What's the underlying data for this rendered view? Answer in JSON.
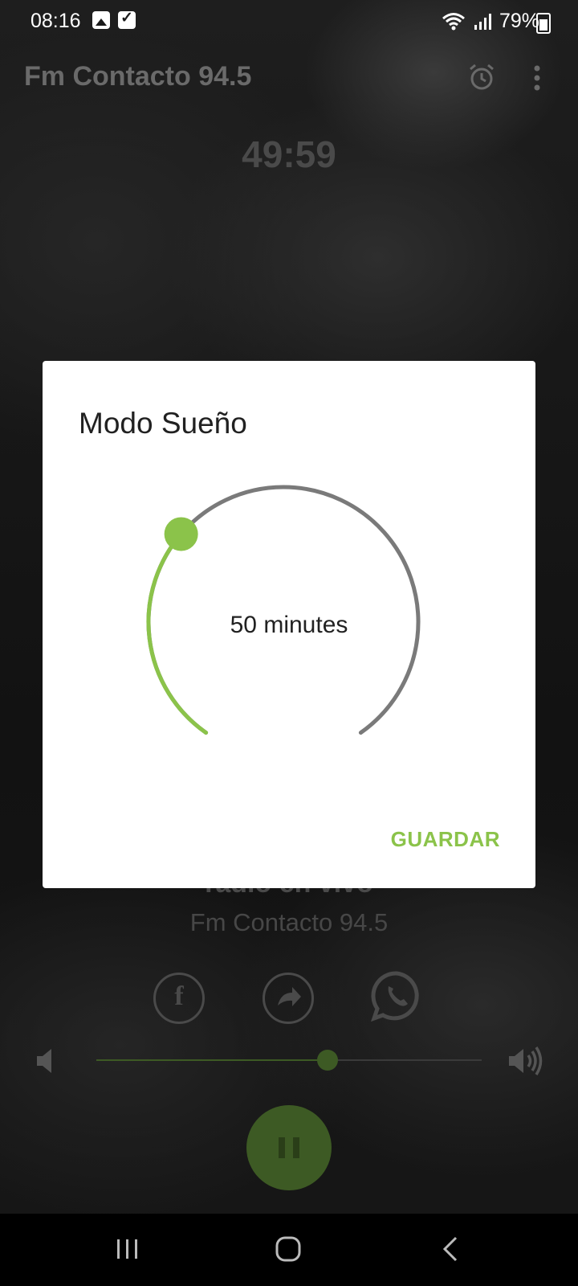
{
  "status_bar": {
    "time": "08:16",
    "battery": "79%",
    "icons": [
      "image-notification-icon",
      "check-notification-icon",
      "wifi-icon",
      "signal-icon",
      "battery-icon"
    ]
  },
  "app_bar": {
    "title": "Fm Contacto 94.5",
    "actions": [
      "alarm-icon",
      "more-vert-icon"
    ]
  },
  "player": {
    "countdown": "49:59",
    "track_title": "radio en vivo",
    "track_subtitle": "Fm Contacto 94.5",
    "share_icons": [
      "facebook-icon",
      "share-icon",
      "whatsapp-icon"
    ],
    "volume_level": 0.6,
    "state": "playing"
  },
  "dialog": {
    "title": "Modo Sueño",
    "dial_value_text": "50 minutes",
    "dial_fraction": 0.33,
    "save_label": "GUARDAR"
  },
  "colors": {
    "accent": "#8bc34a",
    "dial_track": "#7a7a7a",
    "dimmed_accent": "#3d5a24"
  },
  "nav_bar": {
    "buttons": [
      "recent-apps-icon",
      "home-icon",
      "back-icon"
    ]
  }
}
